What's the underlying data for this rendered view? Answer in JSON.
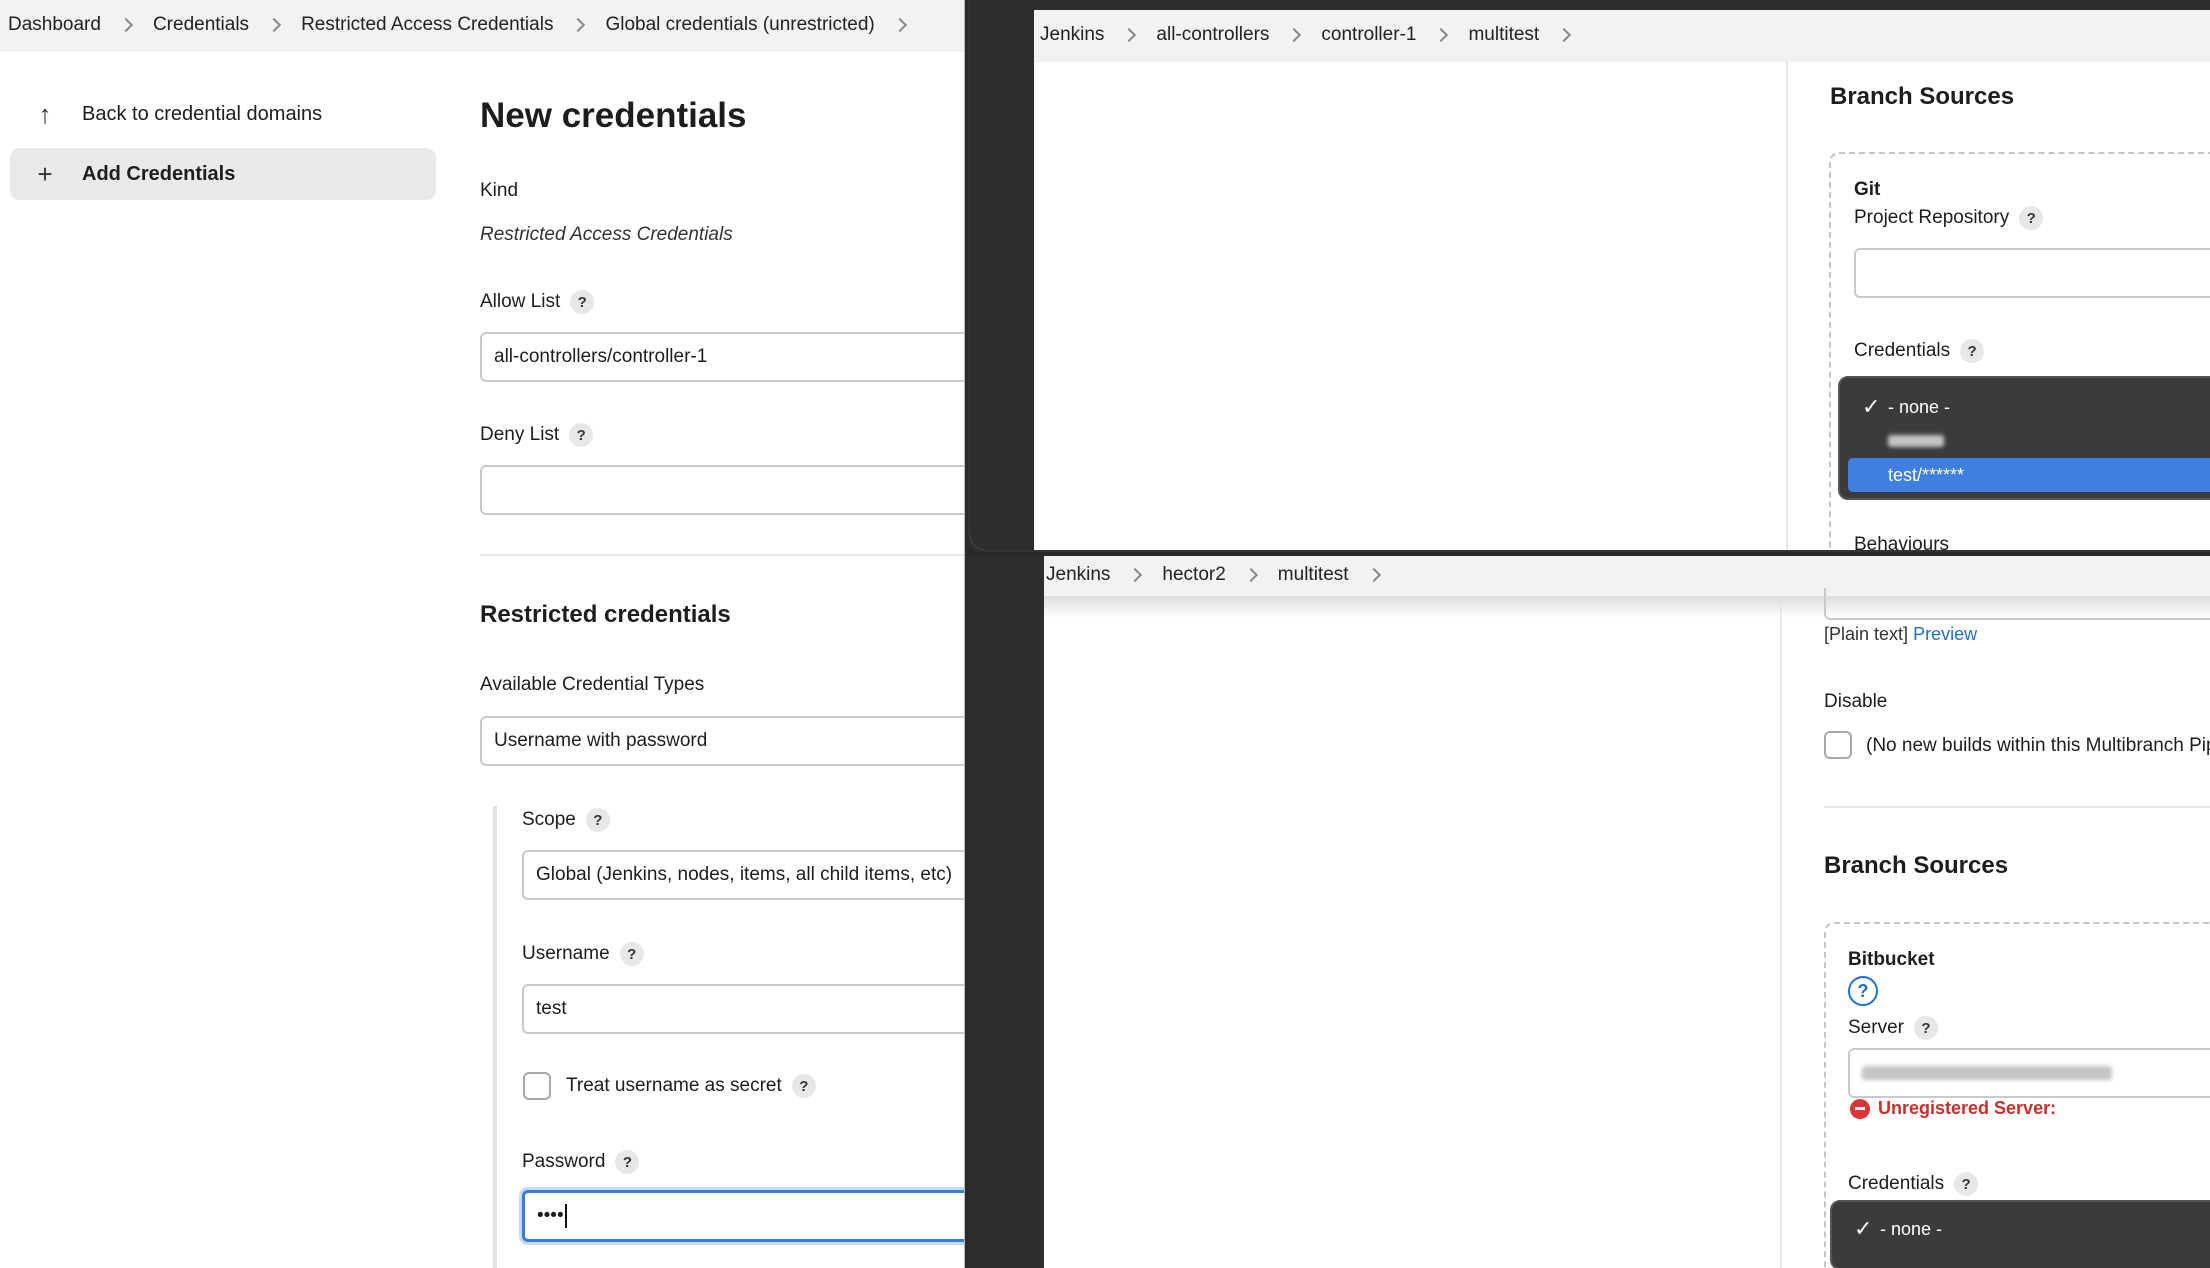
{
  "left": {
    "breadcrumb": [
      "Dashboard",
      "Credentials",
      "Restricted Access Credentials",
      "Global credentials (unrestricted)"
    ],
    "sidebar": {
      "back": "Back to credential domains",
      "add": "Add Credentials"
    },
    "title": "New credentials",
    "kind_label": "Kind",
    "kind_value": "Restricted Access Credentials",
    "allow_label": "Allow List",
    "allow_value": "all-controllers/controller-1",
    "deny_label": "Deny List",
    "deny_value": "",
    "section_title": "Restricted credentials",
    "types_label": "Available Credential Types",
    "types_value": "Username with password",
    "scope_label": "Scope",
    "scope_value": "Global (Jenkins, nodes, items, all child items, etc)",
    "username_label": "Username",
    "username_value": "test",
    "treat_secret_label": "Treat username as secret",
    "password_label": "Password",
    "password_value": "••••",
    "help": "?"
  },
  "top_right": {
    "breadcrumb": [
      "Jenkins",
      "all-controllers",
      "controller-1",
      "multitest"
    ],
    "section_title": "Branch Sources",
    "source_name": "Git",
    "repo_label": "Project Repository",
    "credentials_label": "Credentials",
    "options": [
      "- none -",
      "test/******"
    ],
    "selected_option": "test/******",
    "checked_option": "- none -",
    "behaviours_label": "Behaviours",
    "help": "?"
  },
  "bottom_right": {
    "breadcrumb": [
      "Jenkins",
      "hector2",
      "multitest"
    ],
    "plain_text": "[Plain text]",
    "preview": "Preview",
    "disable_label": "Disable",
    "disable_checkbox_label": "(No new builds within this Multibranch Pip",
    "section_title": "Branch Sources",
    "source_name": "Bitbucket",
    "server_label": "Server",
    "unregistered": "Unregistered Server:",
    "credentials_label": "Credentials",
    "credentials_value": "- none -",
    "help": "?"
  }
}
